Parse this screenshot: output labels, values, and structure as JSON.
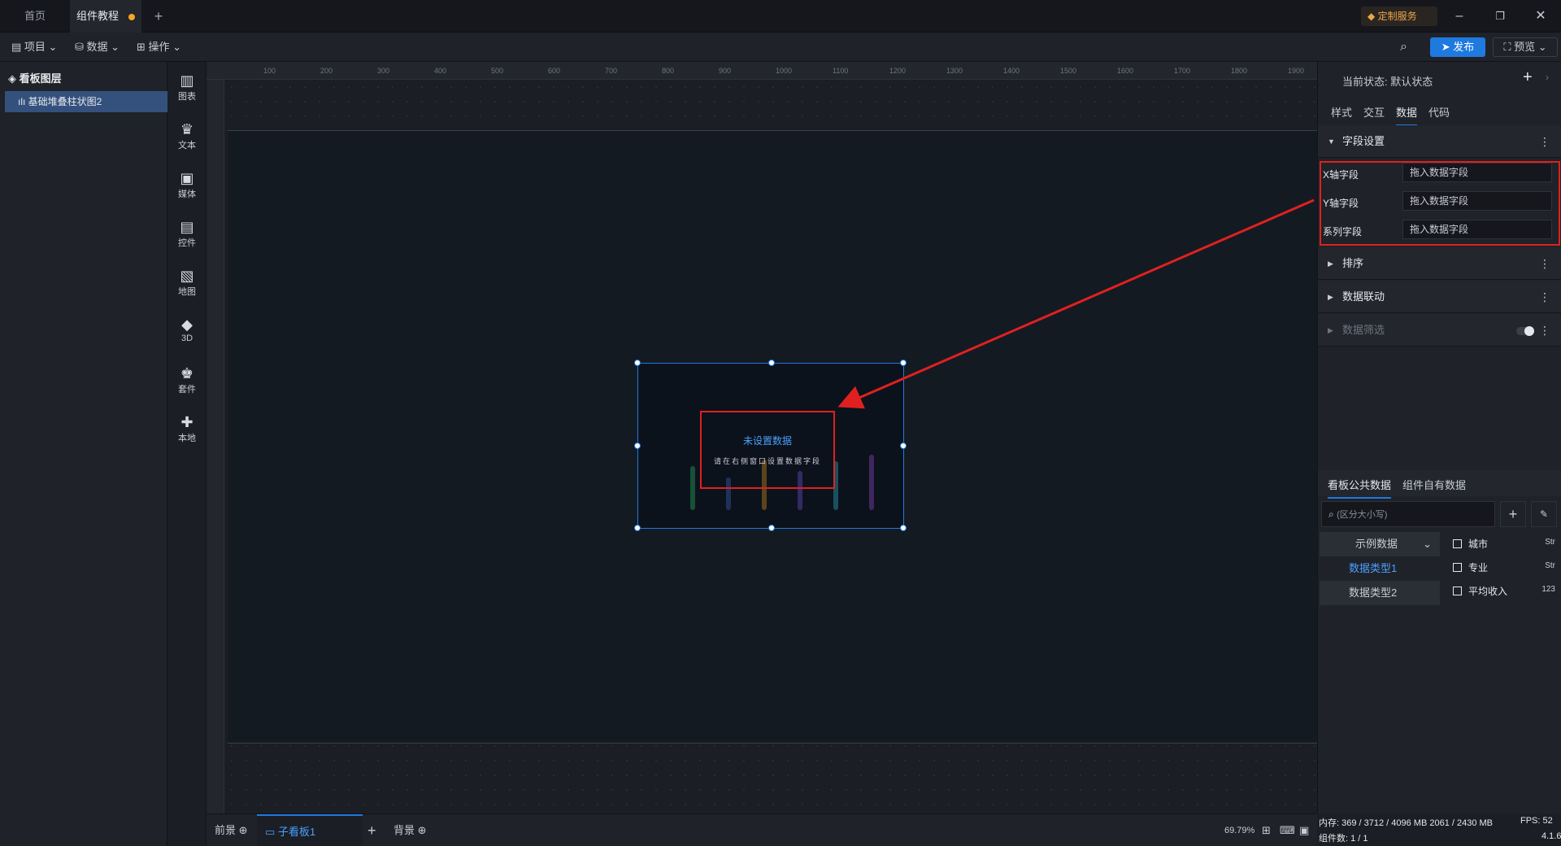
{
  "tabs": [
    {
      "label": "首页"
    },
    {
      "label": "组件教程"
    }
  ],
  "vip_label": "定制服务",
  "toolbar": {
    "project": "项目",
    "data": "数据",
    "operate": "操作",
    "publish": "发布",
    "preview": "预览"
  },
  "layers": {
    "title": "看板图层",
    "item": "基础堆叠柱状图2"
  },
  "components": [
    "图表",
    "文本",
    "媒体",
    "控件",
    "地图",
    "3D",
    "套件",
    "本地"
  ],
  "ruler_top": [
    "100",
    "200",
    "300",
    "400",
    "500",
    "600",
    "700",
    "800",
    "900",
    "1000",
    "1100",
    "1200",
    "1300",
    "1400",
    "1500",
    "1600",
    "1700",
    "1800",
    "1900"
  ],
  "widget": {
    "nodata_title": "未设置数据",
    "nodata_sub": "请在右侧窗口设置数据字段",
    "bar_colors": [
      "#2ecc71",
      "#3b6fd8",
      "#f0a020",
      "#7b5cf0",
      "#34c6e0",
      "#a050e0"
    ]
  },
  "bottombar": {
    "front": "前景",
    "board": "子看板1",
    "background": "背景",
    "zoom": "69.79%"
  },
  "right": {
    "state_label": "当前状态:",
    "state_value": "默认状态",
    "tabs": [
      "样式",
      "交互",
      "数据",
      "代码"
    ],
    "active_tab": "数据",
    "sections": {
      "fields": "字段设置",
      "sort": "排序",
      "linkage": "数据联动",
      "filter": "数据筛选"
    },
    "fields": [
      {
        "label": "X轴字段",
        "value": "拖入数据字段"
      },
      {
        "label": "Y轴字段",
        "value": "拖入数据字段"
      },
      {
        "label": "系列字段",
        "value": "拖入数据字段"
      }
    ],
    "data_tabs": [
      "看板公共数据",
      "组件自有数据"
    ],
    "search_placeholder": "(区分大小写)",
    "dataset_select": "示例数据",
    "datasets": [
      "数据类型1",
      "数据类型2"
    ],
    "columns": [
      {
        "name": "城市",
        "type": "Str"
      },
      {
        "name": "专业",
        "type": "Str"
      },
      {
        "name": "平均收入",
        "type": "123"
      }
    ]
  },
  "status": {
    "memory": "内存: 369 / 3712 / 4096 MB  2061 / 2430 MB",
    "fps": "FPS: 52",
    "components": "组件数: 1 / 1",
    "version": "4.1.6"
  },
  "colors": {
    "accent": "#1f7ae0",
    "highlight": "#e02020",
    "selected_layer": "#34517e"
  }
}
